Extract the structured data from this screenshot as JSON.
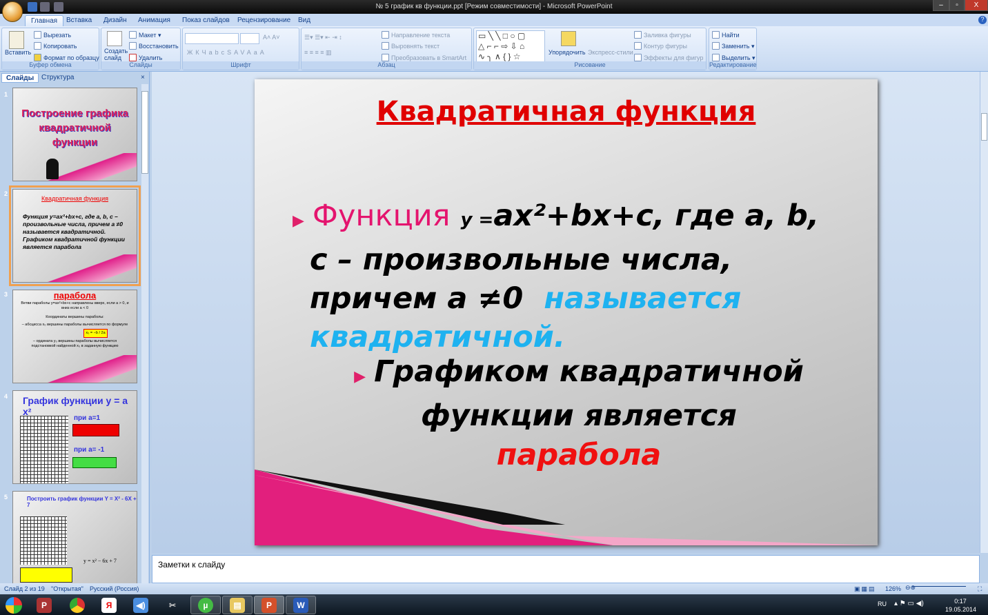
{
  "window": {
    "title": "№ 5 график кв функции.ppt [Режим совместимости] - Microsoft PowerPoint",
    "min": "–",
    "max": "▫",
    "close": "X"
  },
  "tabs": [
    "Главная",
    "Вставка",
    "Дизайн",
    "Анимация",
    "Показ слайдов",
    "Рецензирование",
    "Вид"
  ],
  "ribbon": {
    "clipboard": {
      "paste": "Вставить",
      "cut": "Вырезать",
      "copy": "Копировать",
      "format": "Формат по образцу",
      "label": "Буфер обмена"
    },
    "slides": {
      "new": "Создать слайд",
      "layout": "Макет",
      "reset": "Восстановить",
      "delete": "Удалить",
      "label": "Слайды"
    },
    "font": {
      "label": "Шрифт",
      "bold": "Ж",
      "italic": "К",
      "underline": "Ч",
      "strike": "abc",
      "shadow": "S",
      "spacing": "AV",
      "case": "Aa",
      "color": "A"
    },
    "paragraph": {
      "direction": "Направление текста",
      "align": "Выровнять текст",
      "smartart": "Преобразовать в SmartArt",
      "label": "Абзац"
    },
    "drawing": {
      "arrange": "Упорядочить",
      "styles": "Экспресс-стили",
      "fill": "Заливка фигуры",
      "outline": "Контур фигуры",
      "effects": "Эффекты для фигур",
      "label": "Рисование"
    },
    "editing": {
      "find": "Найти",
      "replace": "Заменить",
      "select": "Выделить",
      "label": "Редактирование"
    }
  },
  "pane": {
    "tabs": [
      "Слайды",
      "Структура"
    ],
    "close": "×"
  },
  "thumbs": [
    {
      "n": "1",
      "title": "Построение графика квадратичной функции"
    },
    {
      "n": "2",
      "title": "Квадратичная функция",
      "text": "Функция y=ax²+bx+c, где a, b, c – произвольные числа, причем a ≠0 называется квадратичной. Графиком квадратичной функции является парабола"
    },
    {
      "n": "3",
      "title": "парабола",
      "l1": "Ветви параболы y=ax²+bx+c направлены вверх, если a > 0, и вниз если a < 0",
      "l2": "Координаты вершины параболы:",
      "l3": "– абсцисса x₀ вершины параболы вычисляется по формуле",
      "f": "x₀ = −b / 2a",
      "l4": "– ордината y₀ вершины параболы вычисляется подстановкой найденной x₀ в заданную функцию"
    },
    {
      "n": "4",
      "title": "График функции y = a x²",
      "a1": "при a=1",
      "a2": "при a= -1"
    },
    {
      "n": "5",
      "title": "Построить график функции  Y = X² - 6X + 7",
      "eq": "y = x² − 6x + 7"
    }
  ],
  "slide": {
    "title": "Квадратичная функция",
    "b1_red": "Функция",
    "b1_y": "y =",
    "b1_formula": "ax²+bx+c, где a, b,",
    "b1_l2": "c – произвольные числа,",
    "b1_l3": "причем a ≠0",
    "b1_cyan1": "называется",
    "b1_cyan2": "квадратичной.",
    "b2_l1": "Графиком квадратичной",
    "b2_l2": "функции является",
    "b2_red": "парабола"
  },
  "notes": {
    "placeholder": "Заметки к слайду"
  },
  "status": {
    "slide": "Слайд 2 из 19",
    "theme": "\"Открытая\"",
    "lang": "Русский (Россия)",
    "zoom": "126%"
  },
  "taskbar": {
    "lang": "RU",
    "time": "0:17",
    "date": "19.05.2014"
  }
}
